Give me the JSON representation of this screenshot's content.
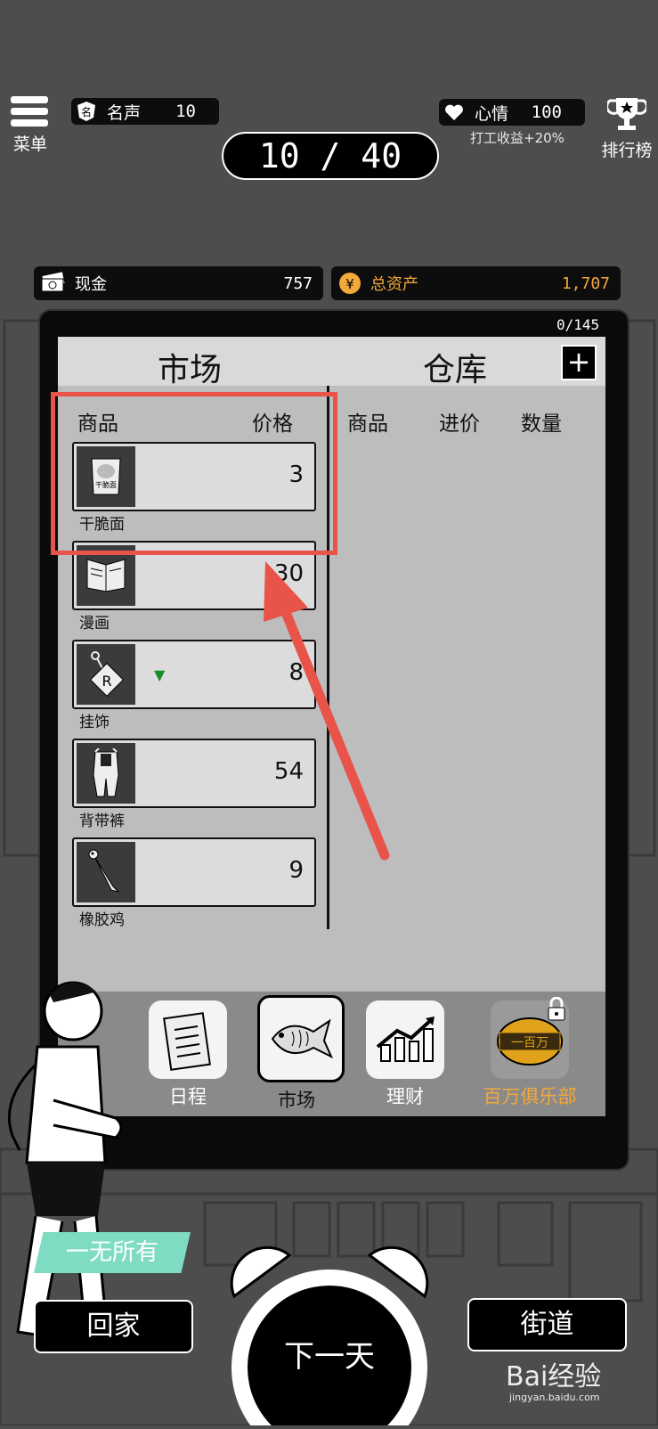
{
  "hud": {
    "menu_label": "菜单",
    "fame_label": "名声",
    "fame_value": "10",
    "mood_label": "心情",
    "mood_value": "100",
    "mood_bonus": "打工收益+20%",
    "leaderboard_label": "排行榜",
    "day_counter": "10 / 40"
  },
  "money": {
    "cash_label": "现金",
    "cash_value": "757",
    "assets_label": "总资产",
    "assets_value": "1,707"
  },
  "panel": {
    "capacity": "0/145",
    "market_tab": "市场",
    "warehouse_tab": "仓库",
    "add_symbol": "+",
    "market_headers": {
      "item": "商品",
      "price": "价格"
    },
    "warehouse_headers": {
      "item": "商品",
      "cost": "进价",
      "qty": "数量"
    },
    "items": [
      {
        "name": "干脆面",
        "price": "3",
        "icon": "noodle-pack-icon",
        "pack_text": "干脆面"
      },
      {
        "name": "漫画",
        "price": "30",
        "icon": "comic-book-icon"
      },
      {
        "name": "挂饰",
        "price": "8",
        "icon": "keychain-icon",
        "trend": "down"
      },
      {
        "name": "背带裤",
        "price": "54",
        "icon": "overalls-icon"
      },
      {
        "name": "橡胶鸡",
        "price": "9",
        "icon": "rubber-chicken-icon"
      }
    ]
  },
  "nav": {
    "schedule": "日程",
    "market": "市场",
    "finance": "理财",
    "club": "百万俱乐部",
    "club_badge": "一百万"
  },
  "bottom": {
    "status_text": "一无所有",
    "home_button": "回家",
    "next_day_button": "下一天",
    "street_button": "街道"
  },
  "watermark": {
    "brand": "Bai经验",
    "url": "jingyan.baidu.com"
  },
  "colors": {
    "accent_orange": "#f2a93b",
    "highlight_red": "#e8534a",
    "status_teal": "#7fdcc2"
  }
}
